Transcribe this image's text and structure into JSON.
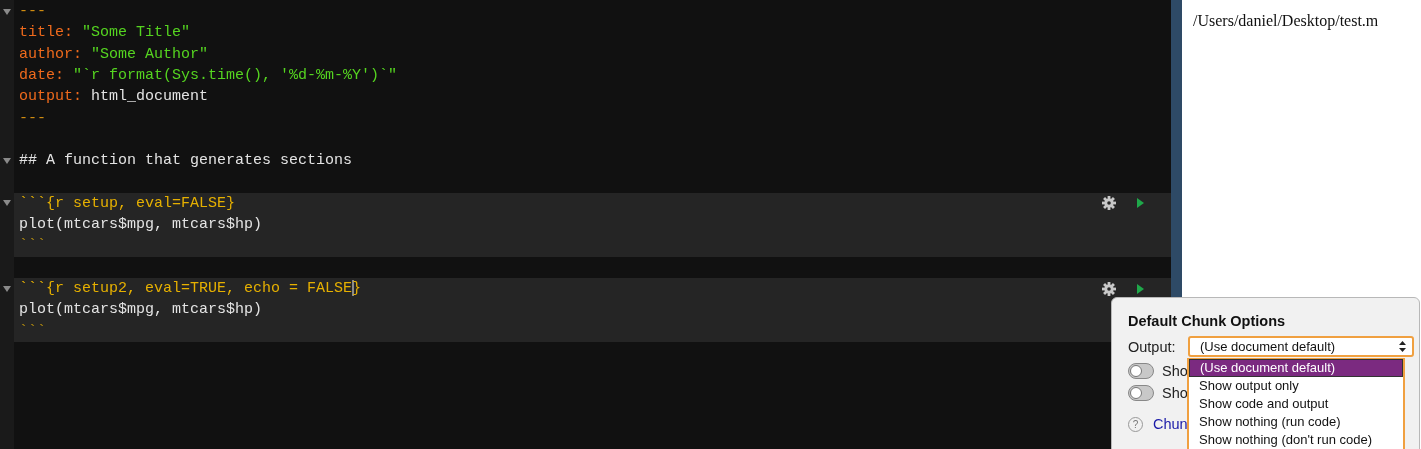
{
  "editor": {
    "lines": [
      {
        "kind": "section",
        "segments": [
          {
            "kind": "dashes",
            "text": "---"
          }
        ]
      },
      {
        "kind": "text",
        "segments": [
          {
            "kind": "key",
            "text": "title: "
          },
          {
            "kind": "string",
            "text": "\"Some Title\""
          }
        ]
      },
      {
        "kind": "text",
        "segments": [
          {
            "kind": "key",
            "text": "author: "
          },
          {
            "kind": "string",
            "text": "\"Some Author\""
          }
        ]
      },
      {
        "kind": "text",
        "segments": [
          {
            "kind": "key",
            "text": "date: "
          },
          {
            "kind": "string",
            "text": "\"`r format(Sys.time(), '%d-%m-%Y')`\""
          }
        ]
      },
      {
        "kind": "text",
        "segments": [
          {
            "kind": "key",
            "text": "output: "
          },
          {
            "kind": "plain",
            "text": "html_document"
          }
        ]
      },
      {
        "kind": "text",
        "segments": [
          {
            "kind": "dashes",
            "text": "---"
          }
        ]
      },
      {
        "kind": "blank"
      },
      {
        "kind": "section",
        "segments": [
          {
            "kind": "plain",
            "text": "## A function that generates sections"
          }
        ]
      },
      {
        "kind": "blank"
      },
      {
        "kind": "chunk_header",
        "segments": [
          {
            "kind": "header",
            "text": "```{r setup, eval=FALSE}"
          }
        ]
      },
      {
        "kind": "chunk_body",
        "segments": [
          {
            "kind": "plain",
            "text": "plot(mtcars$mpg, mtcars$hp)"
          }
        ]
      },
      {
        "kind": "chunk_body",
        "segments": [
          {
            "kind": "fence",
            "text": "```"
          }
        ]
      },
      {
        "kind": "blank"
      },
      {
        "kind": "chunk_header",
        "segments": [
          {
            "kind": "header",
            "text": "```{r setup2, eval=TRUE, echo = FALSE"
          },
          {
            "kind": "cursor"
          },
          {
            "kind": "header",
            "text": "}"
          }
        ]
      },
      {
        "kind": "chunk_body",
        "segments": [
          {
            "kind": "plain",
            "text": "plot(mtcars$mpg, mtcars$hp)"
          }
        ]
      },
      {
        "kind": "chunk_body",
        "segments": [
          {
            "kind": "fence",
            "text": "```"
          }
        ]
      }
    ]
  },
  "viewer": {
    "path": "/Users/daniel/Desktop/test.m"
  },
  "popup": {
    "title": "Default Chunk Options",
    "output_label": "Output:",
    "select": {
      "value": "(Use document default)"
    },
    "toggles": [
      {
        "label": "Sho",
        "on": false
      },
      {
        "label": "Sho",
        "on": false
      }
    ],
    "help_icon": "?",
    "help_link": "Chun",
    "options": [
      {
        "label": "(Use document default)",
        "selected": true
      },
      {
        "label": "Show output only",
        "selected": false
      },
      {
        "label": "Show code and output",
        "selected": false
      },
      {
        "label": "Show nothing (run code)",
        "selected": false
      },
      {
        "label": "Show nothing (don't run code)",
        "selected": false
      }
    ]
  }
}
